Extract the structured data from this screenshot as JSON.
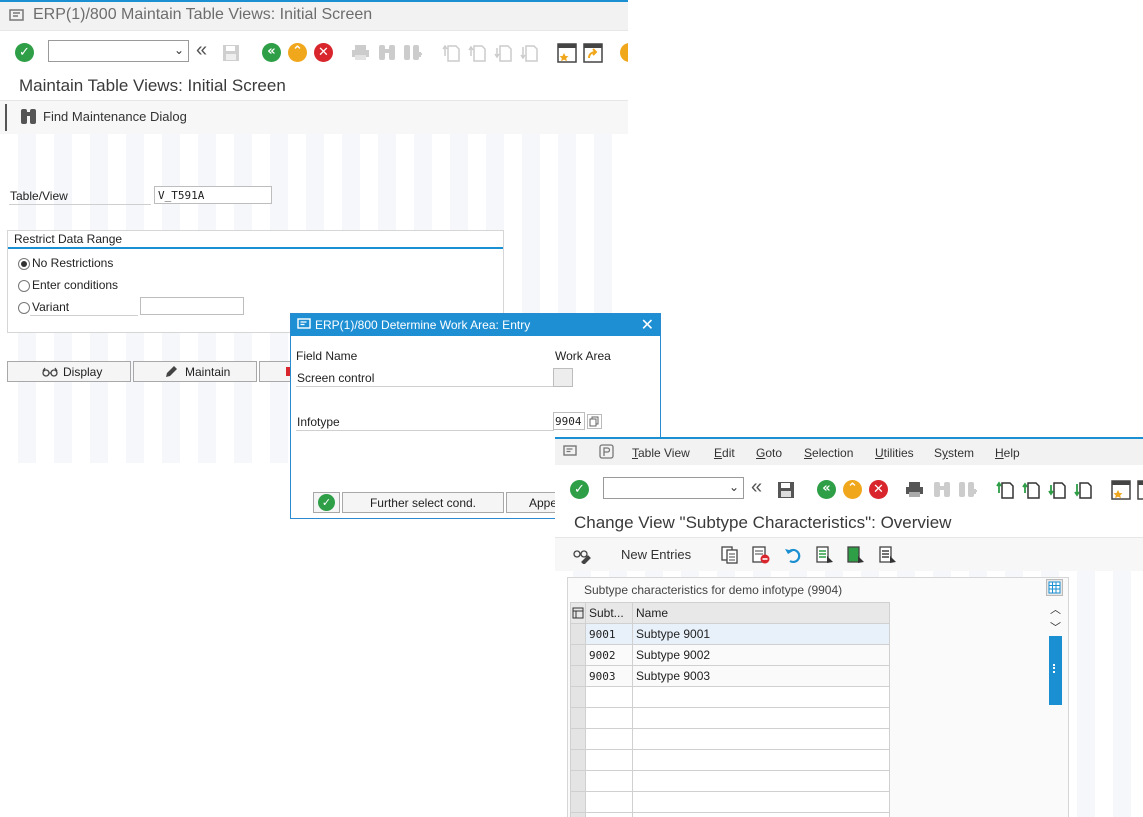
{
  "win1": {
    "title": "ERP(1)/800 Maintain Table Views: Initial Screen",
    "heading": "Maintain Table Views: Initial Screen",
    "find_button": "Find Maintenance Dialog",
    "table_view_label": "Table/View",
    "table_view_value": "V_T591A",
    "restrict_group": {
      "title": "Restrict Data Range",
      "options": [
        "No Restrictions",
        "Enter conditions",
        "Variant"
      ],
      "selected": "No Restrictions"
    },
    "buttons": {
      "display": "Display",
      "maintain": "Maintain"
    }
  },
  "dialog": {
    "title": "ERP(1)/800 Determine Work Area: Entry",
    "col_field": "Field Name",
    "col_work": "Work Area",
    "rows": [
      {
        "field": "Screen control",
        "value": ""
      },
      {
        "field": "Infotype",
        "value": "9904"
      }
    ],
    "further_button": "Further select cond.",
    "append_button": "Appe"
  },
  "win2": {
    "menu": [
      "Table View",
      "Edit",
      "Goto",
      "Selection",
      "Utilities",
      "System",
      "Help"
    ],
    "menu_mnemonic": [
      "T",
      "E",
      "G",
      "S",
      "U",
      "y",
      "H"
    ],
    "heading": "Change View \"Subtype Characteristics\": Overview",
    "new_entries": "New Entries",
    "table_title": "Subtype characteristics for demo infotype (9904)",
    "columns": [
      "Subt...",
      "Name"
    ],
    "rows": [
      {
        "code": "9001",
        "name": "Subtype 9001"
      },
      {
        "code": "9002",
        "name": "Subtype 9002"
      },
      {
        "code": "9003",
        "name": "Subtype 9003"
      }
    ]
  },
  "colors": {
    "accent": "#1f8fd4",
    "ok_green": "#2e9e47",
    "cancel_red": "#d8262c",
    "exit_orange": "#f0a71c"
  }
}
